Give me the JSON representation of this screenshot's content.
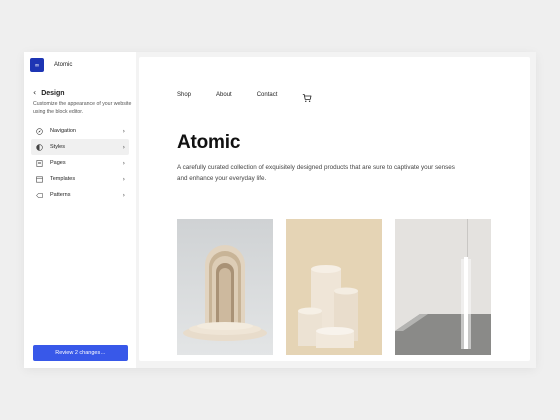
{
  "site": {
    "name": "Atomic",
    "logo_glyph": "∞",
    "logo_color": "#1d35b4"
  },
  "sidebar": {
    "back_icon": "chevron-left-icon",
    "title": "Design",
    "description": "Customize the appearance of your website using the block editor.",
    "items": [
      {
        "label": "Navigation",
        "icon": "compass-icon",
        "active": false
      },
      {
        "label": "Styles",
        "icon": "half-circle-icon",
        "active": true
      },
      {
        "label": "Pages",
        "icon": "page-icon",
        "active": false
      },
      {
        "label": "Templates",
        "icon": "layout-icon",
        "active": false
      },
      {
        "label": "Patterns",
        "icon": "symbol-icon",
        "active": false
      }
    ],
    "review_button": "Review 2 changes…",
    "accent": "#3858e9"
  },
  "preview": {
    "nav": [
      "Shop",
      "About",
      "Contact"
    ],
    "cart_icon": "cart-icon",
    "title": "Atomic",
    "description": "A carefully curated collection of exquisitely designed products that are sure to captivate your senses and enhance your everyday life.",
    "gallery": [
      {
        "name": "arch-sculpture-image"
      },
      {
        "name": "cylinder-pedestals-image"
      },
      {
        "name": "light-tube-image"
      }
    ]
  }
}
